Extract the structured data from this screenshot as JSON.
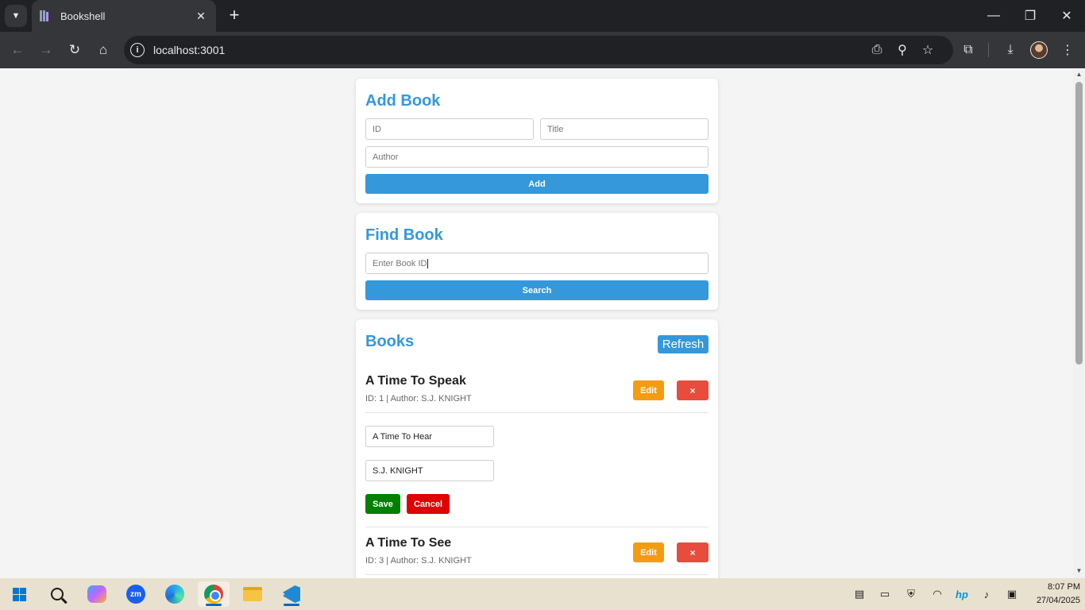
{
  "browser": {
    "tab_title": "Bookshell",
    "url": "localhost:3001"
  },
  "add_book": {
    "heading": "Add Book",
    "id_placeholder": "ID",
    "title_placeholder": "Title",
    "author_placeholder": "Author",
    "add_label": "Add"
  },
  "find_book": {
    "heading": "Find Book",
    "search_placeholder": "Enter Book ID",
    "search_label": "Search"
  },
  "books": {
    "heading": "Books",
    "refresh_label": "Refresh",
    "edit_label": "Edit",
    "delete_label": "×",
    "save_label": "Save",
    "cancel_label": "Cancel",
    "items": [
      {
        "title": "A Time To Speak",
        "meta": "ID: 1 | Author: S.J. KNIGHT"
      },
      {
        "title": "A Time To See",
        "meta": "ID: 3 | Author: S.J. KNIGHT"
      }
    ],
    "edit_form": {
      "title_value": "A Time To Hear",
      "author_value": "S.J. KNIGHT"
    }
  },
  "taskbar": {
    "time": "8:07 PM",
    "date": "27/04/2025",
    "zoom_label": "zm"
  },
  "colors": {
    "accent": "#3498db",
    "edit": "#f39c12",
    "delete": "#e74c3c",
    "save": "#008000",
    "cancel": "#e00000"
  }
}
